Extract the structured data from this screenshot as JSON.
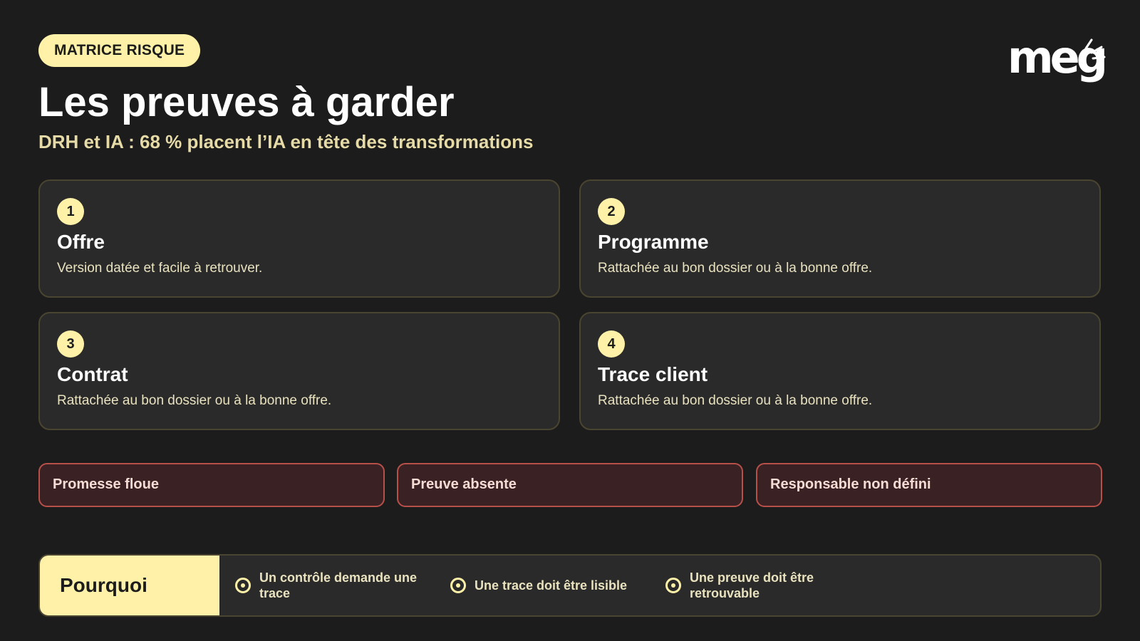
{
  "header": {
    "badge": "MATRICE RISQUE",
    "title": "Les preuves à garder",
    "subtitle": "DRH et IA : 68 % placent l’IA en tête des transformations",
    "logo": "meg"
  },
  "cards": [
    {
      "number": "1",
      "title": "Offre",
      "description": "Version datée et facile à retrouver."
    },
    {
      "number": "2",
      "title": "Programme",
      "description": "Rattachée au bon dossier ou à la bonne offre."
    },
    {
      "number": "3",
      "title": "Contrat",
      "description": "Rattachée au bon dossier ou à la bonne offre."
    },
    {
      "number": "4",
      "title": "Trace client",
      "description": "Rattachée au bon dossier ou à la bonne offre."
    }
  ],
  "risks": [
    "Promesse floue",
    "Preuve absente",
    "Responsable non défini"
  ],
  "why": {
    "label": "Pourquoi",
    "items": [
      "Un contrôle demande une trace",
      "Une trace doit être lisible",
      "Une preuve doit être retrouvable"
    ]
  },
  "colors": {
    "background": "#1c1c1c",
    "accent": "#fff2a8",
    "card": "#2a2a2a",
    "risk_border": "#b8504a",
    "risk_fill": "#3a2224"
  }
}
